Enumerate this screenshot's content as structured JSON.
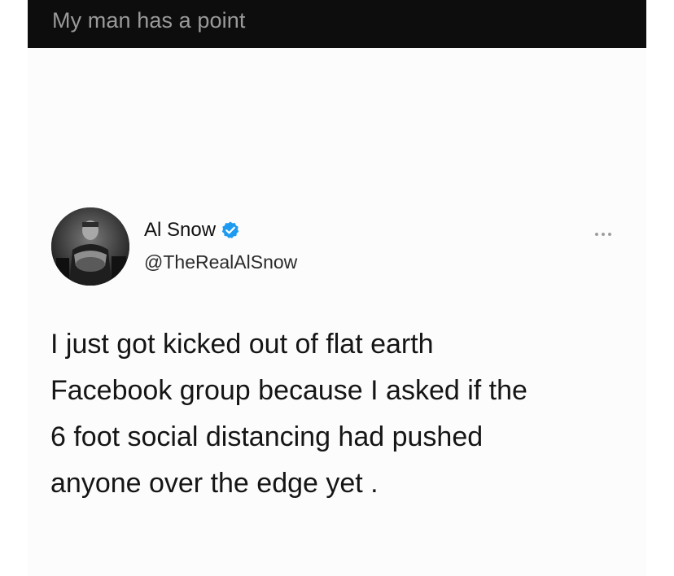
{
  "caption": "My man has a point",
  "tweet": {
    "display_name": "Al Snow",
    "handle": "@TheRealAlSnow",
    "verified": true,
    "text_lines": [
      "I just got kicked out of flat earth",
      "Facebook group because I asked if the",
      "6 foot social distancing had pushed",
      "anyone over the edge yet ."
    ]
  },
  "icons": {
    "verified": "verified-badge-icon",
    "more": "more-options-icon"
  },
  "colors": {
    "caption_bar": "#0d0d0d",
    "caption_text": "#9a9a9a",
    "verified_blue": "#1d9bf0",
    "card_background": "#fcfcfc"
  }
}
